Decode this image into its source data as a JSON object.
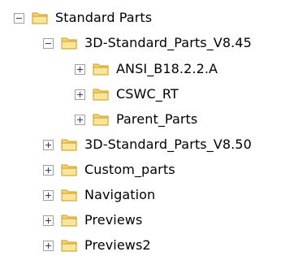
{
  "tree": {
    "nodes": [
      {
        "label": "Standard Parts",
        "state": "expanded"
      },
      {
        "label": "3D-Standard_Parts_V8.45",
        "state": "expanded"
      },
      {
        "label": "ANSI_B18.2.2.A",
        "state": "collapsed"
      },
      {
        "label": "CSWC_RT",
        "state": "collapsed"
      },
      {
        "label": "Parent_Parts",
        "state": "collapsed"
      },
      {
        "label": "3D-Standard_Parts_V8.50",
        "state": "collapsed"
      },
      {
        "label": "Custom_parts",
        "state": "collapsed"
      },
      {
        "label": "Navigation",
        "state": "collapsed"
      },
      {
        "label": "Previews",
        "state": "collapsed"
      },
      {
        "label": "Previews2",
        "state": "collapsed"
      }
    ]
  },
  "icons": {
    "expanded_toggle": "minus-box-icon",
    "collapsed_toggle": "plus-box-icon",
    "folder": "folder-icon"
  },
  "colors": {
    "folder_fill": "#f8d775",
    "folder_dark": "#d9a520",
    "toggle_border": "#a0a0a0",
    "toggle_glyph": "#2a3f7a"
  }
}
